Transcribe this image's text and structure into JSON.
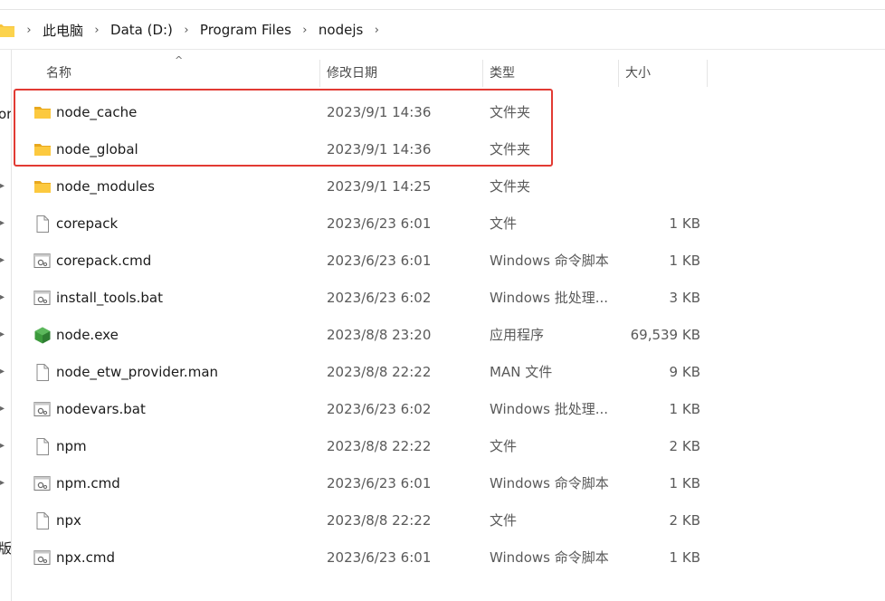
{
  "breadcrumb": {
    "items": [
      "此电脑",
      "Data (D:)",
      "Program Files",
      "nodejs"
    ],
    "separator": "›"
  },
  "columns": {
    "name": "名称",
    "date": "修改日期",
    "type": "类型",
    "size": "大小"
  },
  "nav_fragments": {
    "top": "or",
    "bottom": "版"
  },
  "files": [
    {
      "name": "node_cache",
      "date": "2023/9/1 14:36",
      "type": "文件夹",
      "size": "",
      "icon": "folder-icon"
    },
    {
      "name": "node_global",
      "date": "2023/9/1 14:36",
      "type": "文件夹",
      "size": "",
      "icon": "folder-icon"
    },
    {
      "name": "node_modules",
      "date": "2023/9/1 14:25",
      "type": "文件夹",
      "size": "",
      "icon": "folder-icon"
    },
    {
      "name": "corepack",
      "date": "2023/6/23 6:01",
      "type": "文件",
      "size": "1 KB",
      "icon": "file-icon"
    },
    {
      "name": "corepack.cmd",
      "date": "2023/6/23 6:01",
      "type": "Windows 命令脚本",
      "size": "1 KB",
      "icon": "script-file-icon"
    },
    {
      "name": "install_tools.bat",
      "date": "2023/6/23 6:02",
      "type": "Windows 批处理...",
      "size": "3 KB",
      "icon": "script-file-icon"
    },
    {
      "name": "node.exe",
      "date": "2023/8/8 23:20",
      "type": "应用程序",
      "size": "69,539 KB",
      "icon": "nodejs-app-icon"
    },
    {
      "name": "node_etw_provider.man",
      "date": "2023/8/8 22:22",
      "type": "MAN 文件",
      "size": "9 KB",
      "icon": "file-icon"
    },
    {
      "name": "nodevars.bat",
      "date": "2023/6/23 6:02",
      "type": "Windows 批处理...",
      "size": "1 KB",
      "icon": "script-file-icon"
    },
    {
      "name": "npm",
      "date": "2023/8/8 22:22",
      "type": "文件",
      "size": "2 KB",
      "icon": "file-icon"
    },
    {
      "name": "npm.cmd",
      "date": "2023/6/23 6:01",
      "type": "Windows 命令脚本",
      "size": "1 KB",
      "icon": "script-file-icon"
    },
    {
      "name": "npx",
      "date": "2023/8/8 22:22",
      "type": "文件",
      "size": "2 KB",
      "icon": "file-icon"
    },
    {
      "name": "npx.cmd",
      "date": "2023/6/23 6:01",
      "type": "Windows 命令脚本",
      "size": "1 KB",
      "icon": "script-file-icon"
    }
  ],
  "colors": {
    "folder": "#f8c33a",
    "highlight": "#e23a33",
    "node_green": "#3c9a3c"
  }
}
